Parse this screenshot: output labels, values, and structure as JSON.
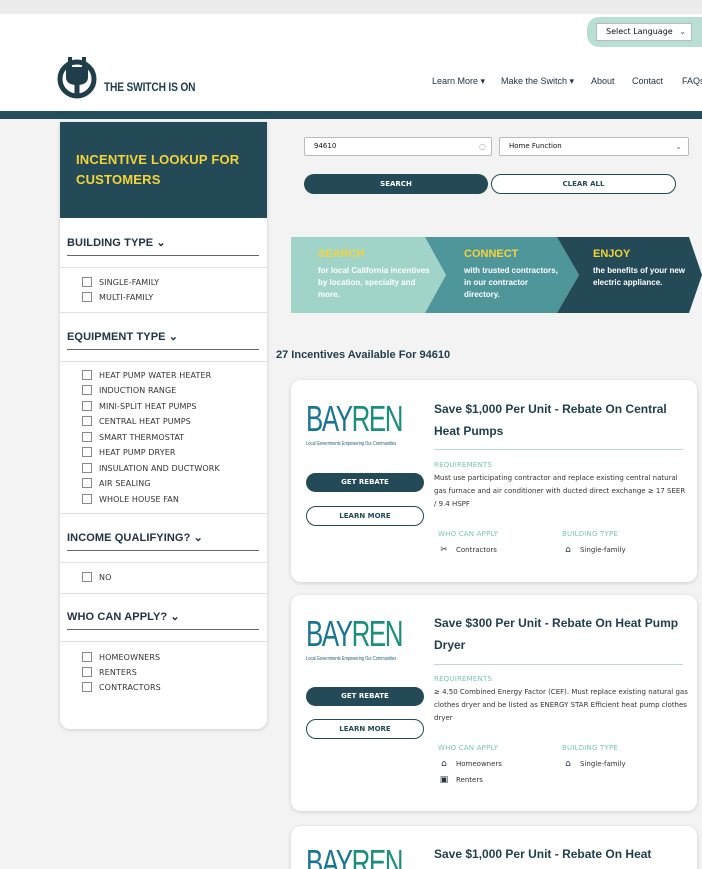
{
  "header": {
    "brand": "THE SWITCH IS ON",
    "language_select": "Select Language",
    "nav": [
      "Learn More ▾",
      "Make the Switch ▾",
      "About",
      "Contact",
      "FAQs"
    ]
  },
  "sidebar": {
    "title": "INCENTIVE LOOKUP FOR CUSTOMERS",
    "sections": [
      {
        "heading": "BUILDING TYPE ⌄",
        "options": [
          "SINGLE-FAMILY",
          "MULTI-FAMILY"
        ]
      },
      {
        "heading": "EQUIPMENT TYPE ⌄",
        "options": [
          "HEAT PUMP WATER HEATER",
          "INDUCTION RANGE",
          "MINI-SPLIT HEAT PUMPS",
          "CENTRAL HEAT PUMPS",
          "SMART THERMOSTAT",
          "HEAT PUMP DRYER",
          "INSULATION AND DUCTWORK",
          "AIR SEALING",
          "WHOLE HOUSE FAN"
        ]
      },
      {
        "heading": "INCOME QUALIFYING? ⌄",
        "options": [
          "NO"
        ]
      },
      {
        "heading": "WHO CAN APPLY? ⌄",
        "options": [
          "HOMEOWNERS",
          "RENTERS",
          "CONTRACTORS"
        ]
      }
    ]
  },
  "search": {
    "zip_value": "94610",
    "function_value": "Home Function",
    "search_label": "SEARCH",
    "clear_label": "CLEAR ALL"
  },
  "banner": {
    "steps": [
      {
        "title": "SEARCH",
        "text": "for local California incentives by location, specialty and more."
      },
      {
        "title": "CONNECT",
        "text": "with trusted contractors, in our contractor directory."
      },
      {
        "title": "ENJOY",
        "text": "the benefits of your new electric appliance."
      }
    ]
  },
  "results": {
    "count_text": "27 Incentives Available For 94610",
    "cards": [
      {
        "logo_bay": "BAY",
        "logo_ren": "REN",
        "logo_tag": "Local Governments Empowering Our Communities",
        "title": "Save $1,000 Per Unit - Rebate On Central Heat Pumps",
        "requirements_label": "REQUIREMENTS",
        "requirements": "Must use participating contractor and replace existing central natural gas furnace and air conditioner with ducted direct exchange ≥ 17 SEER / 9.4 HSPF",
        "who_label": "WHO CAN APPLY",
        "who": [
          "Contractors"
        ],
        "building_label": "BUILDING TYPE",
        "building": [
          "Single-family"
        ],
        "get_label": "GET REBATE",
        "learn_label": "LEARN MORE"
      },
      {
        "logo_bay": "BAY",
        "logo_ren": "REN",
        "logo_tag": "Local Governments Empowering Our Communities",
        "title": "Save $300 Per Unit - Rebate On Heat Pump Dryer",
        "requirements_label": "REQUIREMENTS",
        "requirements": "≥ 4.50 Combined Energy Factor (CEF). Must replace existing natural gas clothes dryer and be listed as ENERGY STAR Efficient heat pump clothes dryer",
        "who_label": "WHO CAN APPLY",
        "who": [
          "Homeowners",
          "Renters"
        ],
        "building_label": "BUILDING TYPE",
        "building": [
          "Single-family"
        ],
        "get_label": "GET REBATE",
        "learn_label": "LEARN MORE"
      },
      {
        "logo_bay": "BAY",
        "logo_ren": "REN",
        "title": "Save $1,000 Per Unit - Rebate On Heat"
      }
    ]
  },
  "colors": {
    "dark_teal": "#234a56",
    "accent_yellow": "#f5d43a",
    "mint": "#9fd3c7",
    "teal": "#3f8f95"
  }
}
